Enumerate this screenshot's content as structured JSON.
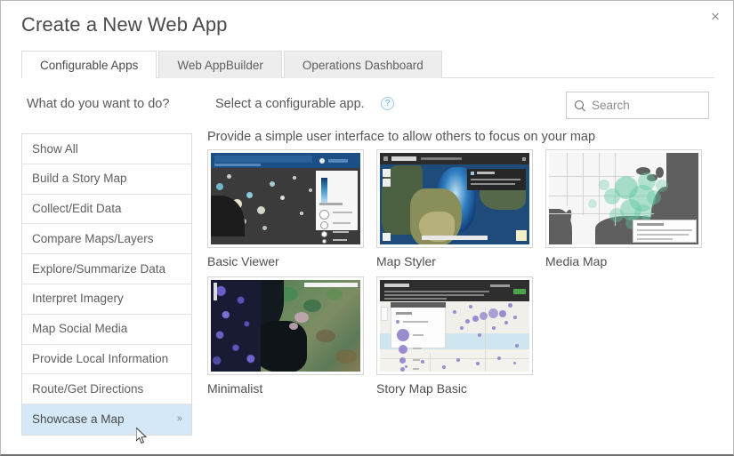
{
  "dialog": {
    "title": "Create a New Web App",
    "close_label": "×"
  },
  "tabs": [
    {
      "label": "Configurable Apps",
      "active": true
    },
    {
      "label": "Web AppBuilder",
      "active": false
    },
    {
      "label": "Operations Dashboard",
      "active": false
    }
  ],
  "headings": {
    "left": "What do you want to do?",
    "right": "Select a configurable app.",
    "help_icon": "?"
  },
  "search": {
    "placeholder": "Search",
    "value": "",
    "icon": "search-icon"
  },
  "sidebar": {
    "items": [
      {
        "label": "Show All",
        "selected": false
      },
      {
        "label": "Build a Story Map",
        "selected": false
      },
      {
        "label": "Collect/Edit Data",
        "selected": false
      },
      {
        "label": "Compare Maps/Layers",
        "selected": false
      },
      {
        "label": "Explore/Summarize Data",
        "selected": false
      },
      {
        "label": "Interpret Imagery",
        "selected": false
      },
      {
        "label": "Map Social Media",
        "selected": false
      },
      {
        "label": "Provide Local Information",
        "selected": false
      },
      {
        "label": "Route/Get Directions",
        "selected": false
      },
      {
        "label": "Showcase a Map",
        "selected": true,
        "chevron": "»"
      }
    ]
  },
  "main": {
    "description": "Provide a simple user interface to allow others to focus on your map",
    "apps": [
      {
        "name": "Basic Viewer",
        "thumb": "basic-viewer"
      },
      {
        "name": "Map Styler",
        "thumb": "map-styler"
      },
      {
        "name": "Media Map",
        "thumb": "media-map"
      },
      {
        "name": "Minimalist",
        "thumb": "minimalist"
      },
      {
        "name": "Story Map Basic",
        "thumb": "story-map-basic"
      }
    ]
  },
  "colors": {
    "selection": "#d4e8f7",
    "accent_blue": "#1c4f86",
    "border": "#dcdcdc",
    "text": "#5e5e5e"
  }
}
